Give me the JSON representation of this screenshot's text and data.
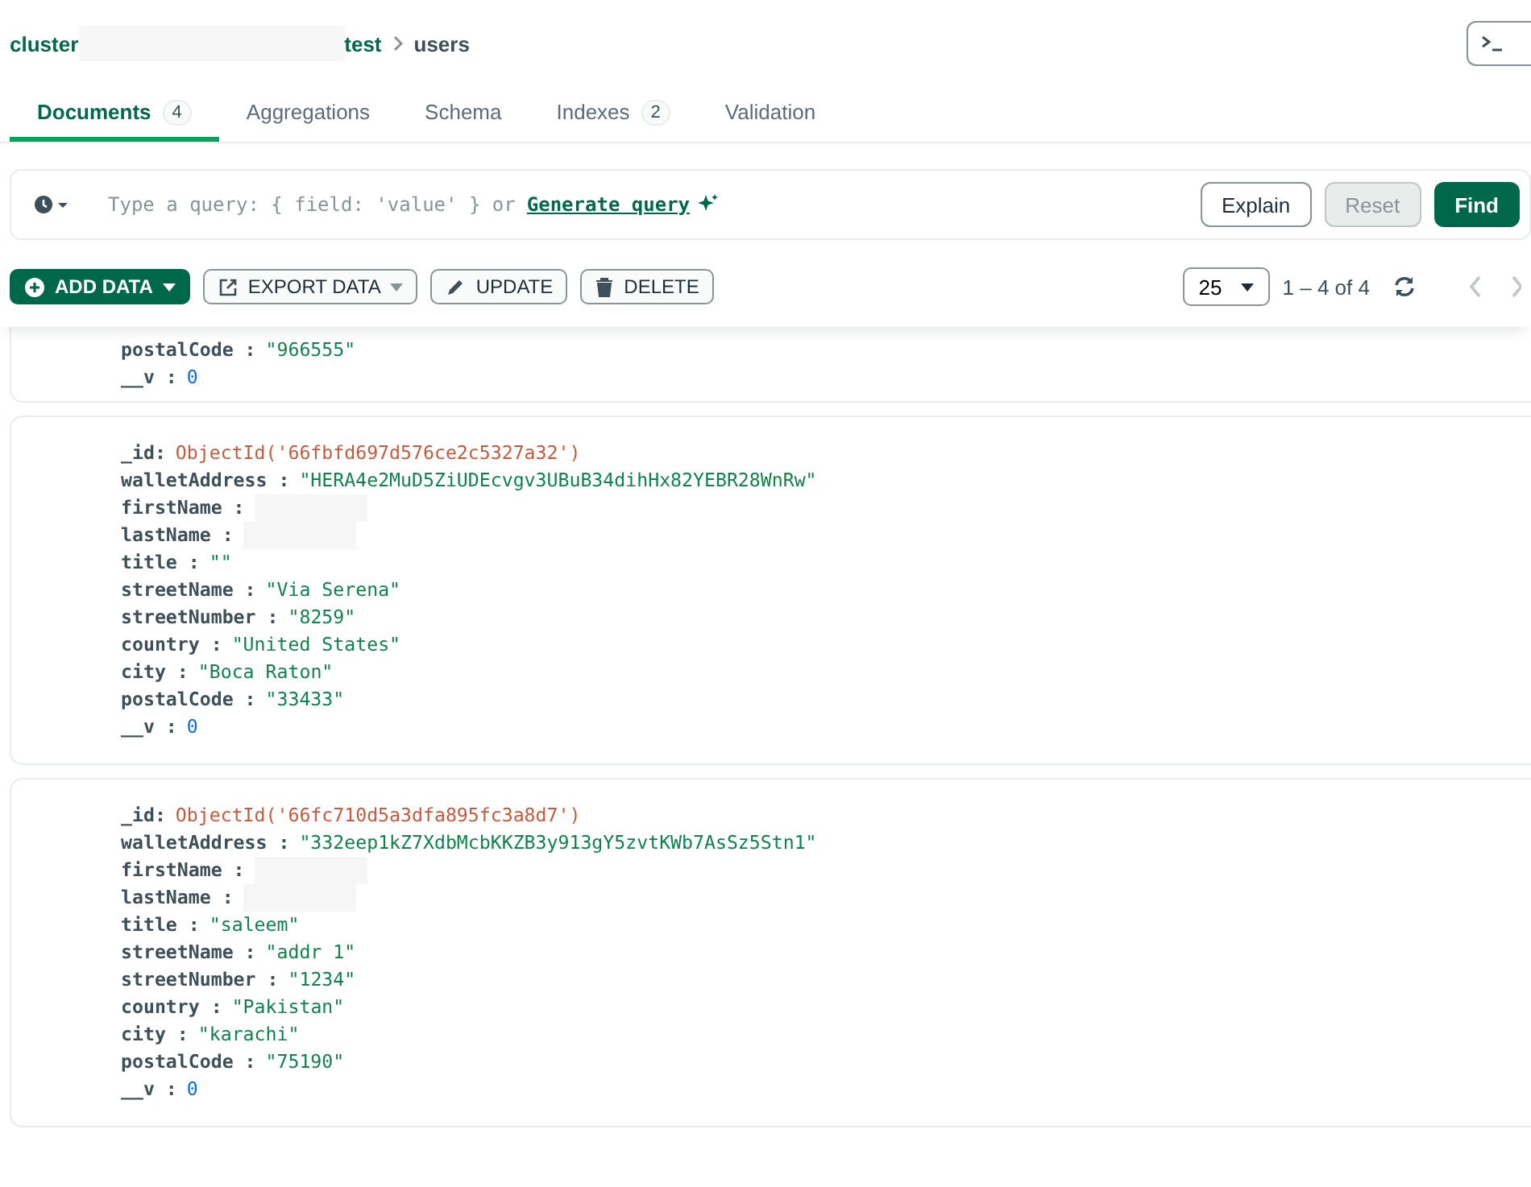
{
  "breadcrumb": {
    "cluster": "cluster",
    "database": "test",
    "collection": "users"
  },
  "tabs": [
    {
      "label": "Documents",
      "count": "4",
      "selected": true
    },
    {
      "label": "Aggregations",
      "selected": false
    },
    {
      "label": "Schema",
      "selected": false
    },
    {
      "label": "Indexes",
      "count": "2",
      "selected": false
    },
    {
      "label": "Validation",
      "selected": false
    }
  ],
  "query": {
    "placeholder": "Type a query: { field: 'value' } or",
    "generate_link": "Generate query",
    "buttons": [
      {
        "label": "Explain",
        "kind": "outline",
        "disabled": false
      },
      {
        "label": "Reset",
        "kind": "outline",
        "disabled": true
      },
      {
        "label": "Find",
        "kind": "primary",
        "disabled": false
      }
    ]
  },
  "toolbar": {
    "actions": [
      {
        "label": "ADD DATA",
        "kind": "add"
      },
      {
        "label": "EXPORT DATA",
        "kind": "export"
      },
      {
        "label": "UPDATE",
        "kind": "update"
      },
      {
        "label": "DELETE",
        "kind": "delete"
      }
    ],
    "page_size": "25",
    "range": "1 – 4 of 4"
  },
  "documents": [
    {
      "fields": [
        {
          "key": "postalCode :",
          "value": "\"966555\"",
          "kind": "string"
        },
        {
          "key": "__v :",
          "value": "0",
          "kind": "number"
        }
      ]
    },
    {
      "fields": [
        {
          "key": "_id:",
          "value": "ObjectId('66fbfd697d576ce2c5327a32')",
          "kind": "objectid"
        },
        {
          "key": "walletAddress :",
          "value": "\"HERA4e2MuD5ZiUDEcvgv3UBuB34dihHx82YEBR28WnRw\"",
          "kind": "string"
        },
        {
          "key": "firstName :",
          "kind": "redacted"
        },
        {
          "key": "lastName :",
          "kind": "redacted"
        },
        {
          "key": "title :",
          "value": "\"\"",
          "kind": "string"
        },
        {
          "key": "streetName :",
          "value": "\"Via Serena\"",
          "kind": "string"
        },
        {
          "key": "streetNumber :",
          "value": "\"8259\"",
          "kind": "string"
        },
        {
          "key": "country :",
          "value": "\"United States\"",
          "kind": "string"
        },
        {
          "key": "city :",
          "value": "\"Boca Raton\"",
          "kind": "string"
        },
        {
          "key": "postalCode :",
          "value": "\"33433\"",
          "kind": "string"
        },
        {
          "key": "__v :",
          "value": "0",
          "kind": "number"
        }
      ]
    },
    {
      "fields": [
        {
          "key": "_id:",
          "value": "ObjectId('66fc710d5a3dfa895fc3a8d7')",
          "kind": "objectid"
        },
        {
          "key": "walletAddress :",
          "value": "\"332eep1kZ7XdbMcbKKZB3y913gY5zvtKWb7AsSz5Stn1\"",
          "kind": "string"
        },
        {
          "key": "firstName :",
          "kind": "redacted"
        },
        {
          "key": "lastName :",
          "kind": "redacted"
        },
        {
          "key": "title :",
          "value": "\"saleem\"",
          "kind": "string"
        },
        {
          "key": "streetName :",
          "value": "\"addr 1\"",
          "kind": "string"
        },
        {
          "key": "streetNumber :",
          "value": "\"1234\"",
          "kind": "string"
        },
        {
          "key": "country :",
          "value": "\"Pakistan\"",
          "kind": "string"
        },
        {
          "key": "city :",
          "value": "\"karachi\"",
          "kind": "string"
        },
        {
          "key": "postalCode :",
          "value": "\"75190\"",
          "kind": "string"
        },
        {
          "key": "__v :",
          "value": "0",
          "kind": "number"
        }
      ]
    }
  ]
}
